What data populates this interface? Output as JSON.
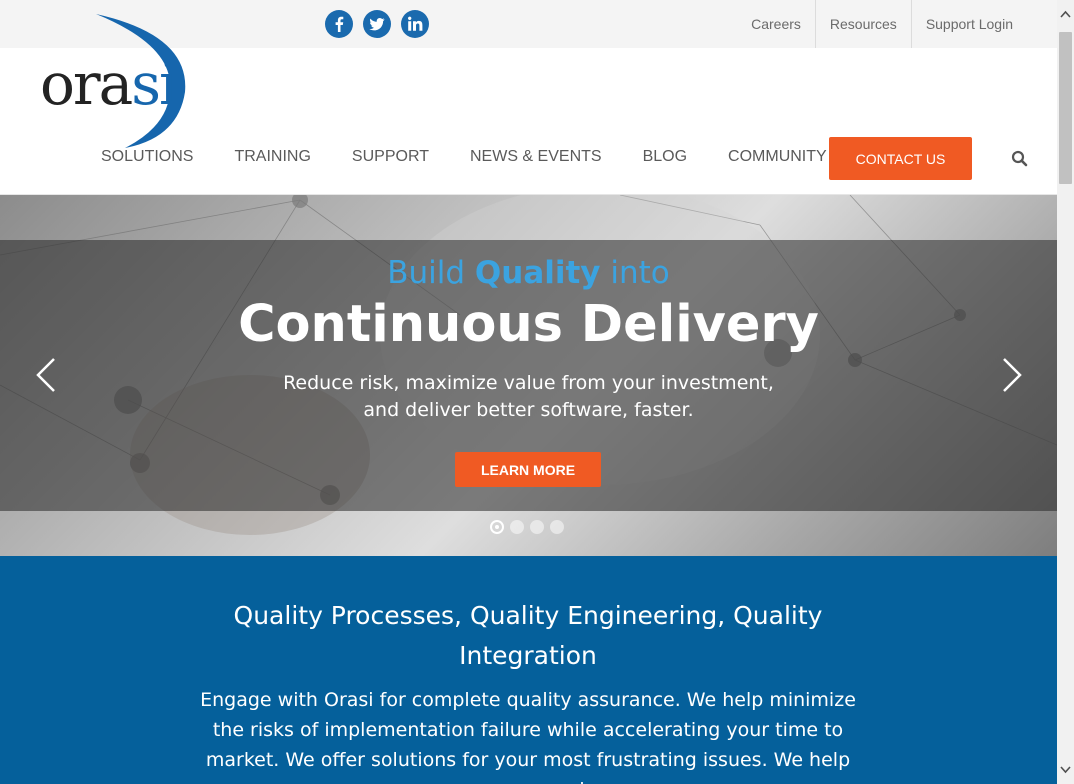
{
  "topbar": {
    "social": [
      {
        "name": "facebook-icon"
      },
      {
        "name": "twitter-icon"
      },
      {
        "name": "linkedin-icon"
      }
    ],
    "links": [
      "Careers",
      "Resources",
      "Support Login"
    ]
  },
  "header": {
    "logo_text_1": "ora",
    "logo_text_2": "si",
    "nav": [
      "SOLUTIONS",
      "TRAINING",
      "SUPPORT",
      "NEWS & EVENTS",
      "BLOG",
      "COMMUNITY"
    ],
    "contact_label": "CONTACT US",
    "search_icon": "search-icon"
  },
  "hero": {
    "kicker_part1": "Build ",
    "kicker_part2": "Quality",
    "kicker_part3": " into",
    "title": "Continuous Delivery",
    "subtitle_line1": "Reduce risk, maximize value from your investment,",
    "subtitle_line2": "and deliver better software, faster.",
    "button_label": "LEARN MORE",
    "slide_count": 4,
    "active_slide": 1
  },
  "section": {
    "title": "Quality Processes, Quality Engineering, Quality Integration",
    "body": "Engage with Orasi for complete quality assurance. We help minimize the risks of implementation failure while accelerating your time to market. We offer solutions for your most frustrating issues. We help you succeed."
  },
  "colors": {
    "brand_blue": "#1666ad",
    "accent_orange": "#f05a23",
    "section_blue": "#05609b",
    "kicker_blue": "#3ba3e0"
  }
}
